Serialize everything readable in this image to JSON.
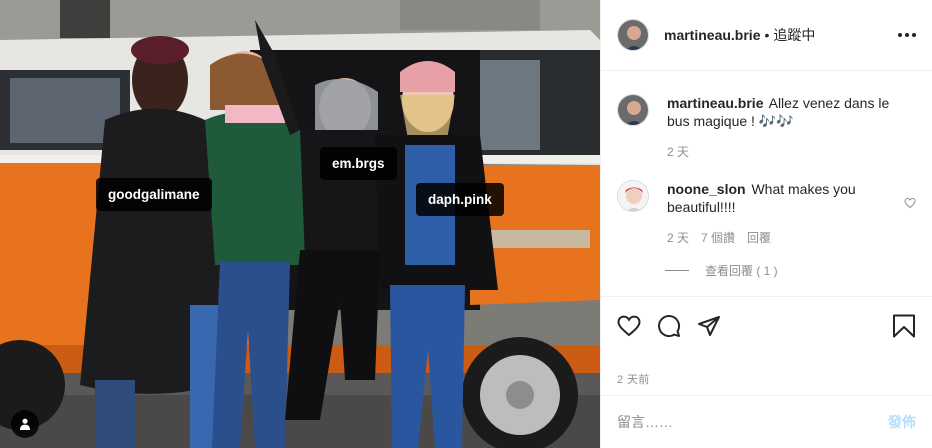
{
  "header": {
    "username": "martineau.brie",
    "separator": "•",
    "follow_status": "追蹤中"
  },
  "photo": {
    "tags": [
      {
        "label": "goodgalimane"
      },
      {
        "label": "em.brgs"
      },
      {
        "label": "daph.pink"
      }
    ],
    "user_tags_icon": "person-icon"
  },
  "caption": {
    "username": "martineau.brie",
    "text": "Allez venez dans le bus magique ! 🎶🎶",
    "age": "2 天"
  },
  "comments": [
    {
      "username": "noone_slon",
      "text": "What makes you beautiful!!!!",
      "age": "2 天",
      "likes": "7 個讚",
      "reply_label": "回覆",
      "view_replies": "查看回覆 ( 1 )"
    }
  ],
  "actions": {
    "icons": [
      "heart-icon",
      "comment-icon",
      "share-icon",
      "bookmark-icon"
    ]
  },
  "timestamp": "2 天前",
  "add_comment": {
    "placeholder": "留言……",
    "post_label": "發佈"
  },
  "colors": {
    "text": "#262626",
    "secondary": "#8e8e8e",
    "border": "#efefef",
    "post_disabled": "#b2dffc",
    "van_orange": "#e8731e"
  }
}
